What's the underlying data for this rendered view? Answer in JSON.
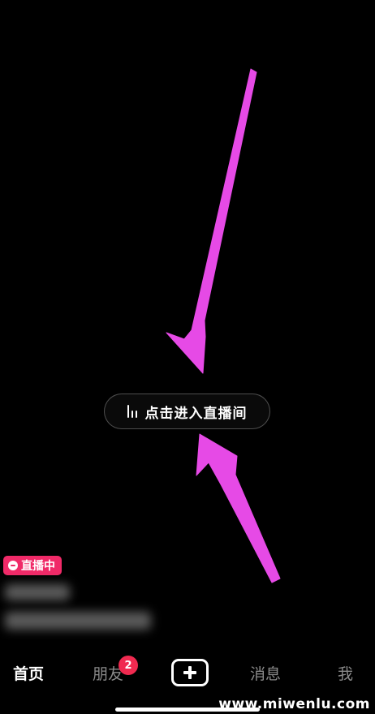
{
  "live_entry": {
    "label": "点击进入直播间",
    "icon": "audio-bars-icon"
  },
  "live_badge": {
    "label": "直播中",
    "icon": "chat-bubble-icon",
    "color": "#f02a68"
  },
  "tabbar": {
    "home": "首页",
    "friends": "朋友",
    "friends_badge": "2",
    "create_icon": "plus-icon",
    "messages": "消息",
    "me": "我"
  },
  "watermark": "www.miwenlu.com",
  "colors": {
    "background": "#000000",
    "arrow": "#e64ae6",
    "badge": "#f02a50",
    "tab_active": "#ffffff",
    "tab_inactive": "#8a8a8a"
  }
}
